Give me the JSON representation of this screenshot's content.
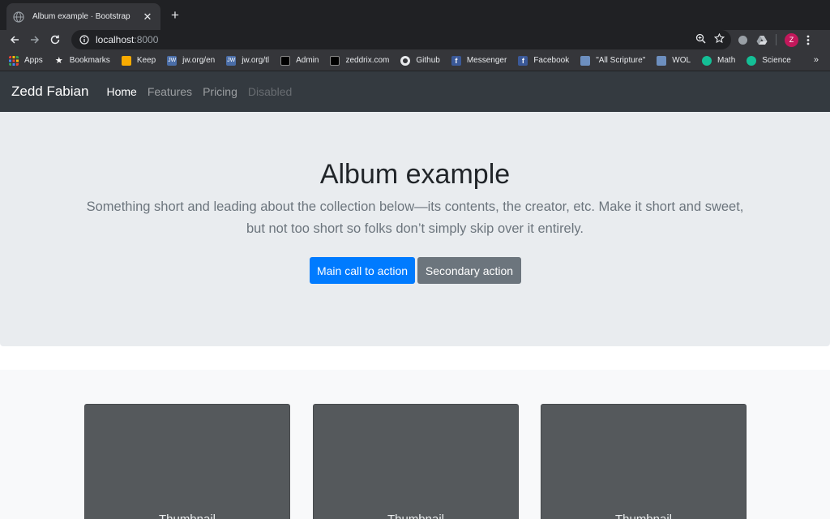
{
  "browser": {
    "tab_title": "Album example · Bootstrap",
    "url_host": "localhost",
    "url_port": ":8000",
    "avatar_letter": "Z",
    "more_bookmarks": "»",
    "bookmarks": [
      {
        "label": "Apps",
        "icon": "apps-grid-icon"
      },
      {
        "label": "Bookmarks",
        "icon": "star-icon"
      },
      {
        "label": "Keep",
        "icon": "keep-icon"
      },
      {
        "label": "jw.org/en",
        "icon": "jw-icon"
      },
      {
        "label": "jw.org/tl",
        "icon": "jw-icon"
      },
      {
        "label": "Admin",
        "icon": "admin-icon"
      },
      {
        "label": "zeddrix.com",
        "icon": "admin-icon"
      },
      {
        "label": "Github",
        "icon": "github-icon"
      },
      {
        "label": "Messenger",
        "icon": "facebook-icon"
      },
      {
        "label": "Facebook",
        "icon": "facebook-icon"
      },
      {
        "label": "\"All Scripture\"",
        "icon": "wol-icon"
      },
      {
        "label": "WOL",
        "icon": "wol-icon"
      },
      {
        "label": "Math",
        "icon": "khan-icon"
      },
      {
        "label": "Science",
        "icon": "khan-icon"
      }
    ]
  },
  "navbar": {
    "brand": "Zedd Fabian",
    "links": [
      {
        "label": "Home",
        "state": "active"
      },
      {
        "label": "Features",
        "state": "normal"
      },
      {
        "label": "Pricing",
        "state": "normal"
      },
      {
        "label": "Disabled",
        "state": "disabled"
      }
    ]
  },
  "jumbotron": {
    "title": "Album example",
    "lead": "Something short and leading about the collection below—its contents, the creator, etc. Make it short and sweet, but not too short so folks don’t simply skip over it entirely.",
    "primary_button": "Main call to action",
    "secondary_button": "Secondary action"
  },
  "album": {
    "cards": [
      {
        "label": "Thumbnail"
      },
      {
        "label": "Thumbnail"
      },
      {
        "label": "Thumbnail"
      }
    ]
  },
  "colors": {
    "navbar_bg": "#343a40",
    "jumbotron_bg": "#e9ecef",
    "primary": "#007bff",
    "secondary": "#6c757d",
    "thumbnail_bg": "#55595c"
  }
}
